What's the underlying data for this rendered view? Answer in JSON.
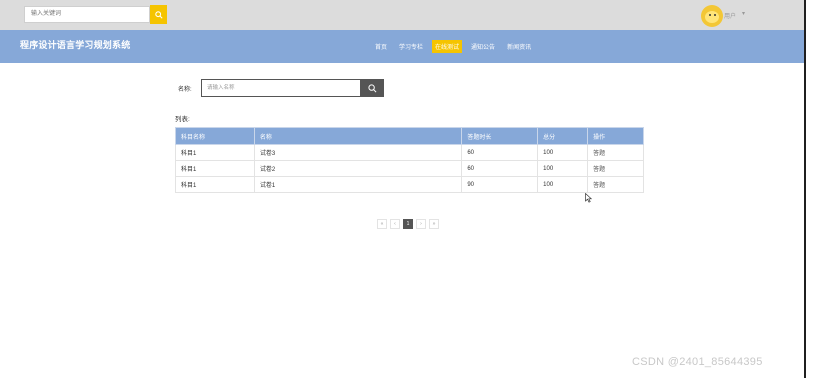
{
  "topbar": {
    "search_placeholder": "输入关键词",
    "user_name": "用户",
    "caret": "▾"
  },
  "header": {
    "site_title": "程序设计语言学习规划系统",
    "nav": [
      {
        "label": "首页",
        "active": false
      },
      {
        "label": "学习专栏",
        "active": false
      },
      {
        "label": "在线测试",
        "active": true
      },
      {
        "label": "通知公告",
        "active": false
      },
      {
        "label": "新闻资讯",
        "active": false
      }
    ]
  },
  "filter": {
    "label": "名称:",
    "placeholder": "请输入名称"
  },
  "list": {
    "label": "列表:",
    "columns": [
      "科目名称",
      "名称",
      "答题时长",
      "总分",
      "操作"
    ],
    "rows": [
      {
        "subject": "科目1",
        "name": "试卷3",
        "duration": "60",
        "score": "100",
        "action": "答题"
      },
      {
        "subject": "科目1",
        "name": "试卷2",
        "duration": "60",
        "score": "100",
        "action": "答题"
      },
      {
        "subject": "科目1",
        "name": "试卷1",
        "duration": "90",
        "score": "100",
        "action": "答题"
      }
    ]
  },
  "pagination": {
    "first": "«",
    "prev": "‹",
    "current": "1",
    "next": "›",
    "last": "»"
  },
  "watermark": "CSDN @2401_85644395",
  "icons": {
    "top_search": "search-icon",
    "filter_search": "search-icon",
    "cursor": "mouse-cursor-icon"
  },
  "colors": {
    "accent_yellow": "#f5c400",
    "nav_blue": "#86a8d8",
    "dark_button": "#555555"
  }
}
